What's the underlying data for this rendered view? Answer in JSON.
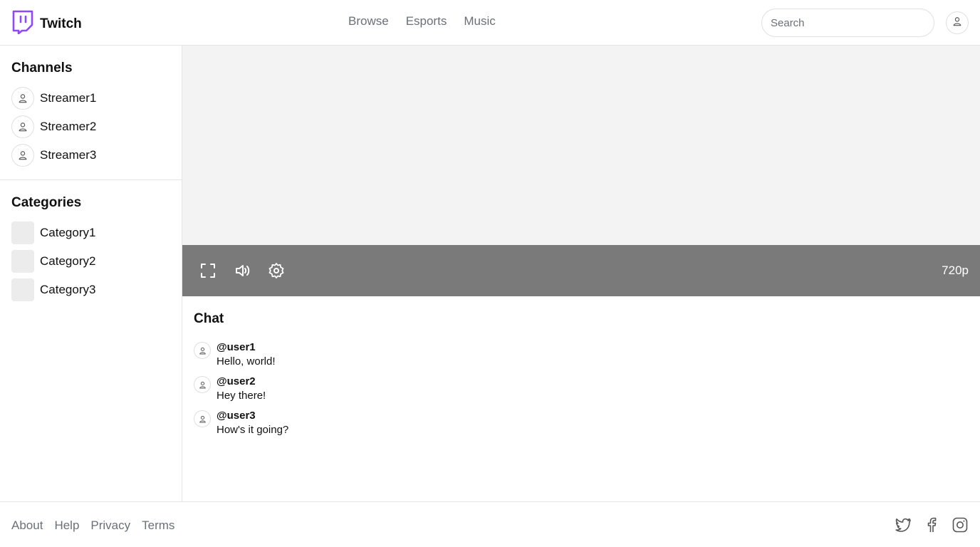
{
  "header": {
    "logo_text": "Twitch",
    "logo_icon": "twitch-logo-icon",
    "brand_color": "#9146ff",
    "nav": [
      {
        "label": "Browse"
      },
      {
        "label": "Esports"
      },
      {
        "label": "Music"
      }
    ],
    "search_placeholder": "Search",
    "user_icon": "user-icon"
  },
  "sidebar": {
    "channels_title": "Channels",
    "channels": [
      {
        "name": "Streamer1"
      },
      {
        "name": "Streamer2"
      },
      {
        "name": "Streamer3"
      }
    ],
    "categories_title": "Categories",
    "categories": [
      {
        "name": "Category1"
      },
      {
        "name": "Category2"
      },
      {
        "name": "Category3"
      }
    ]
  },
  "player": {
    "controls": [
      "fullscreen-icon",
      "volume-icon",
      "settings-icon"
    ],
    "quality": "720p"
  },
  "chat": {
    "title": "Chat",
    "messages": [
      {
        "user": "@user1",
        "text": "Hello, world!"
      },
      {
        "user": "@user2",
        "text": "Hey there!"
      },
      {
        "user": "@user3",
        "text": "How's it going?"
      }
    ]
  },
  "footer": {
    "links": [
      {
        "label": "About"
      },
      {
        "label": "Help"
      },
      {
        "label": "Privacy"
      },
      {
        "label": "Terms"
      }
    ],
    "social": [
      "twitter-icon",
      "facebook-icon",
      "instagram-icon"
    ]
  }
}
